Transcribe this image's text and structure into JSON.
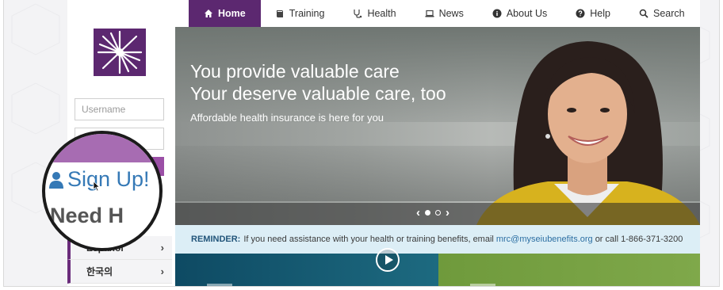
{
  "nav": {
    "items": [
      {
        "label": "Home",
        "icon": "home-icon",
        "active": true
      },
      {
        "label": "Training",
        "icon": "book-icon"
      },
      {
        "label": "Health",
        "icon": "stethoscope-icon"
      },
      {
        "label": "News",
        "icon": "laptop-icon"
      },
      {
        "label": "About Us",
        "icon": "info-icon"
      },
      {
        "label": "Help",
        "icon": "question-icon"
      },
      {
        "label": "Search",
        "icon": "search-icon"
      }
    ]
  },
  "sidebar": {
    "username_placeholder": "Username",
    "password_placeholder": "",
    "languages": [
      {
        "label": "Español"
      },
      {
        "label": "한국의"
      }
    ]
  },
  "magnifier": {
    "signup_label": "Sign Up!",
    "need_label": "Need H"
  },
  "hero": {
    "title_line1": "You provide valuable care",
    "title_line2": "Your deserve valuable care, too",
    "subtitle": "Affordable health insurance is here for you"
  },
  "reminder": {
    "label": "REMINDER:",
    "text_before": "If you need assistance with your health or training benefits, email",
    "email": "mrc@myseiubenefits.org",
    "text_after": "or call 1-866-371-3200"
  },
  "colors": {
    "brand_purple": "#5c2870",
    "accent_purple": "#9b4fa6",
    "reminder_bg": "#dceef6",
    "link_blue": "#2d6fa3"
  }
}
